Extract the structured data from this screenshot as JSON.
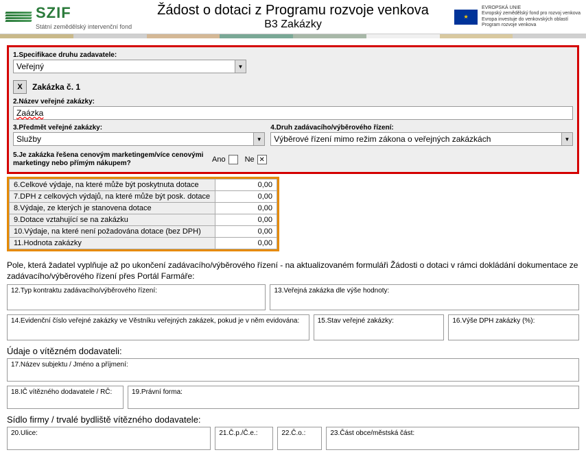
{
  "header": {
    "logo_sub": "Státní zemědělský intervenční fond",
    "title": "Žádost o dotaci z Programu rozvoje venkova",
    "subtitle": "B3 Zakázky",
    "eu1": "EVROPSKÁ UNIE",
    "eu2": "Evropský zemědělský fond pro rozvoj venkova",
    "eu3": "Evropa investuje do venkovských oblastí",
    "eu4": "Program rozvoje venkova"
  },
  "colorbar": [
    "#c9b98a",
    "#d0d0d0",
    "#d4b896",
    "#7aa896",
    "#a8b8a8",
    "#f0f0f0",
    "#d9c9a0",
    "#d0d0d0"
  ],
  "f1": {
    "label": "1.Specifikace druhu zadavatele:",
    "value": "Veřejný"
  },
  "zakazka": {
    "x": "X",
    "title": "Zakázka č. 1"
  },
  "f2": {
    "label": "2.Název veřejné zakázky:",
    "value": "Zaázka"
  },
  "f3": {
    "label": "3.Předmět veřejné zakázky:",
    "value": "Služby"
  },
  "f4": {
    "label": "4.Druh zadávacího/výběrového řízení:",
    "value": "Výběrové řízení mimo režim zákona o veřejných zakázkách"
  },
  "f5": {
    "label": "5.Je zakázka řešena cenovým marketingem/více cenovými marketingy nebo přímým nákupem?",
    "ano": "Ano",
    "ne": "Ne"
  },
  "fin": [
    {
      "l": "6.Celkové výdaje, na které může být poskytnuta dotace",
      "v": "0,00"
    },
    {
      "l": "7.DPH z celkových výdajů, na které může být posk. dotace",
      "v": "0,00"
    },
    {
      "l": "8.Výdaje, ze kterých je stanovena dotace",
      "v": "0,00"
    },
    {
      "l": "9.Dotace vztahující se na zakázku",
      "v": "0,00"
    },
    {
      "l": "10.Výdaje, na které není požadována dotace (bez DPH)",
      "v": "0,00"
    },
    {
      "l": "11.Hodnota zakázky",
      "v": "0,00"
    }
  ],
  "note": "Pole, která žadatel vyplňuje až po ukončení zadávacího/výběrového řízení - na aktualizovaném formuláři Žádosti o dotaci v rámci dokládání dokumentace ze zadávacího/výběrového řízení přes Portál Farmáře:",
  "f12": "12.Typ kontraktu zadávacího/výběrového řízení:",
  "f13": "13.Veřejná zakázka dle výše hodnoty:",
  "f14": "14.Evidenční číslo veřejné zakázky ve Věstníku veřejných zakázek, pokud je v něm evidována:",
  "f15": "15.Stav veřejné zakázky:",
  "f16": "16.Výše DPH zakázky (%):",
  "sec_dodavatel": "Údaje o vítězném dodavateli:",
  "f17": "17.Název subjektu / Jméno a příjmení:",
  "f18": "18.IČ vítězného dodavatele / RČ:",
  "f19": "19.Právní forma:",
  "sec_sidlo": "Sídlo firmy / trvalé bydliště vítězného dodavatele:",
  "f20": "20.Ulice:",
  "f21": "21.Č.p./Č.e.:",
  "f22": "22.Č.o.:",
  "f23": "23.Část obce/městská část:"
}
